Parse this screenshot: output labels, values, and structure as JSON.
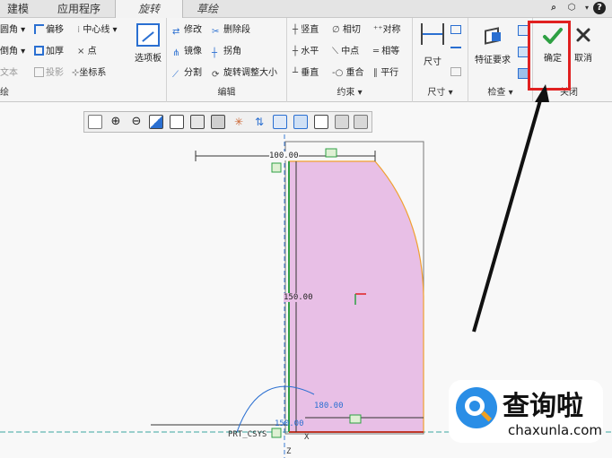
{
  "tabs": [
    {
      "label": "建模"
    },
    {
      "label": "应用程序"
    },
    {
      "label": "旋转"
    },
    {
      "label": "草绘"
    }
  ],
  "ribbon": {
    "sketch": {
      "label": "绘",
      "items": [
        "圆角",
        "倒角",
        "文本",
        "偏移",
        "加厚",
        "投影",
        "中心线",
        "点",
        "坐标系"
      ],
      "palette": "选项板"
    },
    "edit": {
      "label": "编辑",
      "items": [
        "修改",
        "删除段",
        "镜像",
        "拐角",
        "分割",
        "旋转调整大小"
      ]
    },
    "constrain": {
      "label": "约束",
      "items": [
        "竖直",
        "相切",
        "对称",
        "水平",
        "中点",
        "相等",
        "垂直",
        "重合",
        "平行"
      ]
    },
    "dimension": {
      "label": "尺寸",
      "big": "尺寸"
    },
    "inspect": {
      "label": "检查",
      "big": "特征要求"
    },
    "close": {
      "label": "关闭",
      "ok": "确定",
      "cancel": "取消"
    }
  },
  "sketch": {
    "dim_top": "100.00",
    "dim_height": "150.00",
    "dim_bottom": "180.00",
    "dim_bottom_left": "150.00",
    "csys": "PRT_CSYS",
    "axis_x": "X",
    "axis_z": "Z"
  },
  "watermark": {
    "title": "查询啦",
    "url": "chaxunla.com"
  },
  "colors": {
    "fill": "#e8bfe6",
    "accent_green": "#2ea043",
    "highlight_red": "#e02020"
  }
}
